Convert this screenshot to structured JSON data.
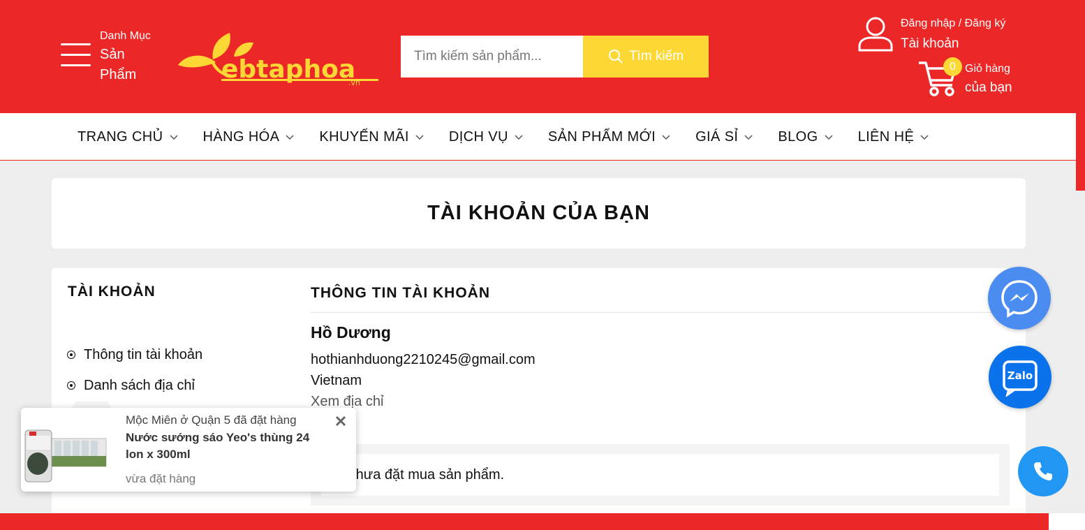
{
  "header": {
    "category": {
      "small": "Danh Mục",
      "line1": "Sản",
      "line2": "Phẩm"
    },
    "logo_text": "ebtaphoa",
    "logo_domain": ".vn",
    "search": {
      "placeholder": "Tìm kiếm sản phẩm...",
      "button_label": "Tìm kiếm"
    },
    "account": {
      "login_register": "Đăng nhập / Đăng ký",
      "label": "Tài khoản"
    },
    "cart": {
      "count": "0",
      "line1": "Giỏ hàng",
      "line2": "của bạn"
    }
  },
  "nav": {
    "items": [
      {
        "label": "TRANG CHỦ"
      },
      {
        "label": "HÀNG HÓA"
      },
      {
        "label": "KHUYẾN MÃI"
      },
      {
        "label": "DỊCH VỤ"
      },
      {
        "label": "SẢN PHẨM MỚI"
      },
      {
        "label": "GIÁ SỈ"
      },
      {
        "label": "BLOG"
      },
      {
        "label": "LIÊN HỆ"
      }
    ]
  },
  "page": {
    "title": "TÀI KHOẢN CỦA BẠN"
  },
  "sidebar": {
    "title": "TÀI KHOẢN",
    "items": [
      {
        "label": "Thông tin tài khoản"
      },
      {
        "label": "Danh sách địa chỉ"
      }
    ]
  },
  "account_info": {
    "title": "THÔNG TIN TÀI KHOẢN",
    "name": "Hồ Dương",
    "email": "hothianhduong2210245@gmail.com",
    "country": "Vietnam",
    "address_link": "Xem địa chỉ"
  },
  "orders": {
    "empty_message": "n chưa đặt mua sản phẩm."
  },
  "toast": {
    "who": "Mộc Miên ở Quận 5 đã đặt hàng",
    "product": "Nước sướng sáo Yeo's thùng 24 lon x 300ml",
    "when": "vừa đặt hàng"
  },
  "fabs": {
    "zalo_label": "Zalo"
  },
  "colors": {
    "brand_red": "#ec2727",
    "accent_yellow": "#fdd835",
    "messenger_blue": "#4a8cf0",
    "zalo_blue": "#0a72ea",
    "phone_blue": "#2196f3"
  },
  "icons": [
    "hamburger-icon",
    "search-icon",
    "user-icon",
    "cart-icon",
    "chevron-down-icon",
    "radio-bullet-icon",
    "messenger-icon",
    "zalo-icon",
    "phone-icon",
    "close-icon"
  ]
}
